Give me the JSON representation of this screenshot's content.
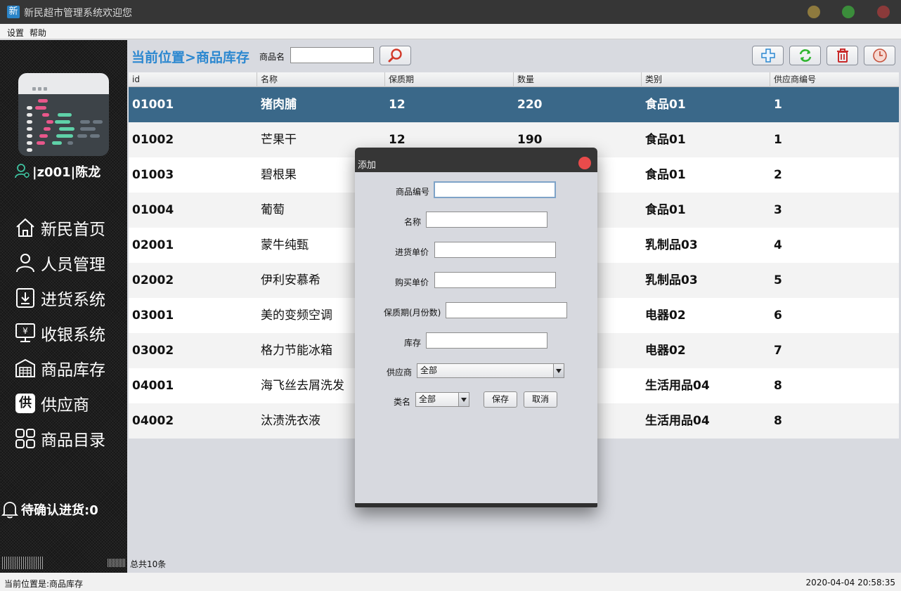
{
  "window": {
    "app_icon_char": "新",
    "title": "新民超市管理系统欢迎您"
  },
  "menu": {
    "items": [
      "设置",
      "帮助"
    ]
  },
  "sidebar": {
    "user": "|z001|陈龙",
    "nav": [
      {
        "label": "新民首页",
        "icon": "home-icon"
      },
      {
        "label": "人员管理",
        "icon": "person-icon"
      },
      {
        "label": "进货系统",
        "icon": "inbox-download-icon"
      },
      {
        "label": "收银系统",
        "icon": "cashier-monitor-icon"
      },
      {
        "label": "商品库存",
        "icon": "warehouse-icon"
      },
      {
        "label": "供应商",
        "icon": "supplier-badge-icon"
      },
      {
        "label": "商品目录",
        "icon": "grid-catalog-icon"
      }
    ],
    "supplier_icon_char": "供",
    "cashier_icon_char": "¥",
    "pending": "待确认进货:0"
  },
  "main": {
    "breadcrumb": "当前位置>商品库存",
    "search_label": "商品名",
    "search_value": "",
    "toolbar": [
      "add-icon",
      "refresh-icon",
      "delete-icon",
      "clock-icon"
    ],
    "table": {
      "columns": [
        "id",
        "名称",
        "保质期",
        "数量",
        "类别",
        "供应商编号"
      ],
      "rows": [
        [
          "01001",
          "猪肉脯",
          "12",
          "220",
          "食品01",
          "1"
        ],
        [
          "01002",
          "芒果干",
          "12",
          "190",
          "食品01",
          "1"
        ],
        [
          "01003",
          "碧根果",
          "",
          "",
          "食品01",
          "2"
        ],
        [
          "01004",
          "葡萄",
          "",
          "",
          "食品01",
          "3"
        ],
        [
          "02001",
          "蒙牛纯甄",
          "",
          "",
          "乳制品03",
          "4"
        ],
        [
          "02002",
          "伊利安慕希",
          "",
          "",
          "乳制品03",
          "5"
        ],
        [
          "03001",
          "美的变频空调",
          "",
          "",
          "电器02",
          "6"
        ],
        [
          "03002",
          "格力节能冰箱",
          "",
          "",
          "电器02",
          "7"
        ],
        [
          "04001",
          "海飞丝去屑洗发",
          "",
          "",
          "生活用品04",
          "8"
        ],
        [
          "04002",
          "汰渍洗衣液",
          "",
          "",
          "生活用品04",
          "8"
        ]
      ],
      "selected_row": 0
    },
    "footer_count": "总共10条"
  },
  "status": {
    "left": "当前位置是:商品库存",
    "right": "2020-04-04 20:58:35"
  },
  "dialog": {
    "title": "添加",
    "fields": {
      "code_label": "商品编号",
      "name_label": "名称",
      "purchase_price_label": "进货单价",
      "sale_price_label": "购买单价",
      "shelf_life_label": "保质期(月份数)",
      "stock_label": "库存",
      "supplier_label": "供应商",
      "supplier_value": "全部",
      "category_label": "类名",
      "category_value": "全部"
    },
    "save_label": "保存",
    "cancel_label": "取消"
  },
  "colors": {
    "accent": "#2c88d0",
    "selected_row": "#3a6889",
    "titlebar": "#363636",
    "close_red": "#e94b4b"
  }
}
